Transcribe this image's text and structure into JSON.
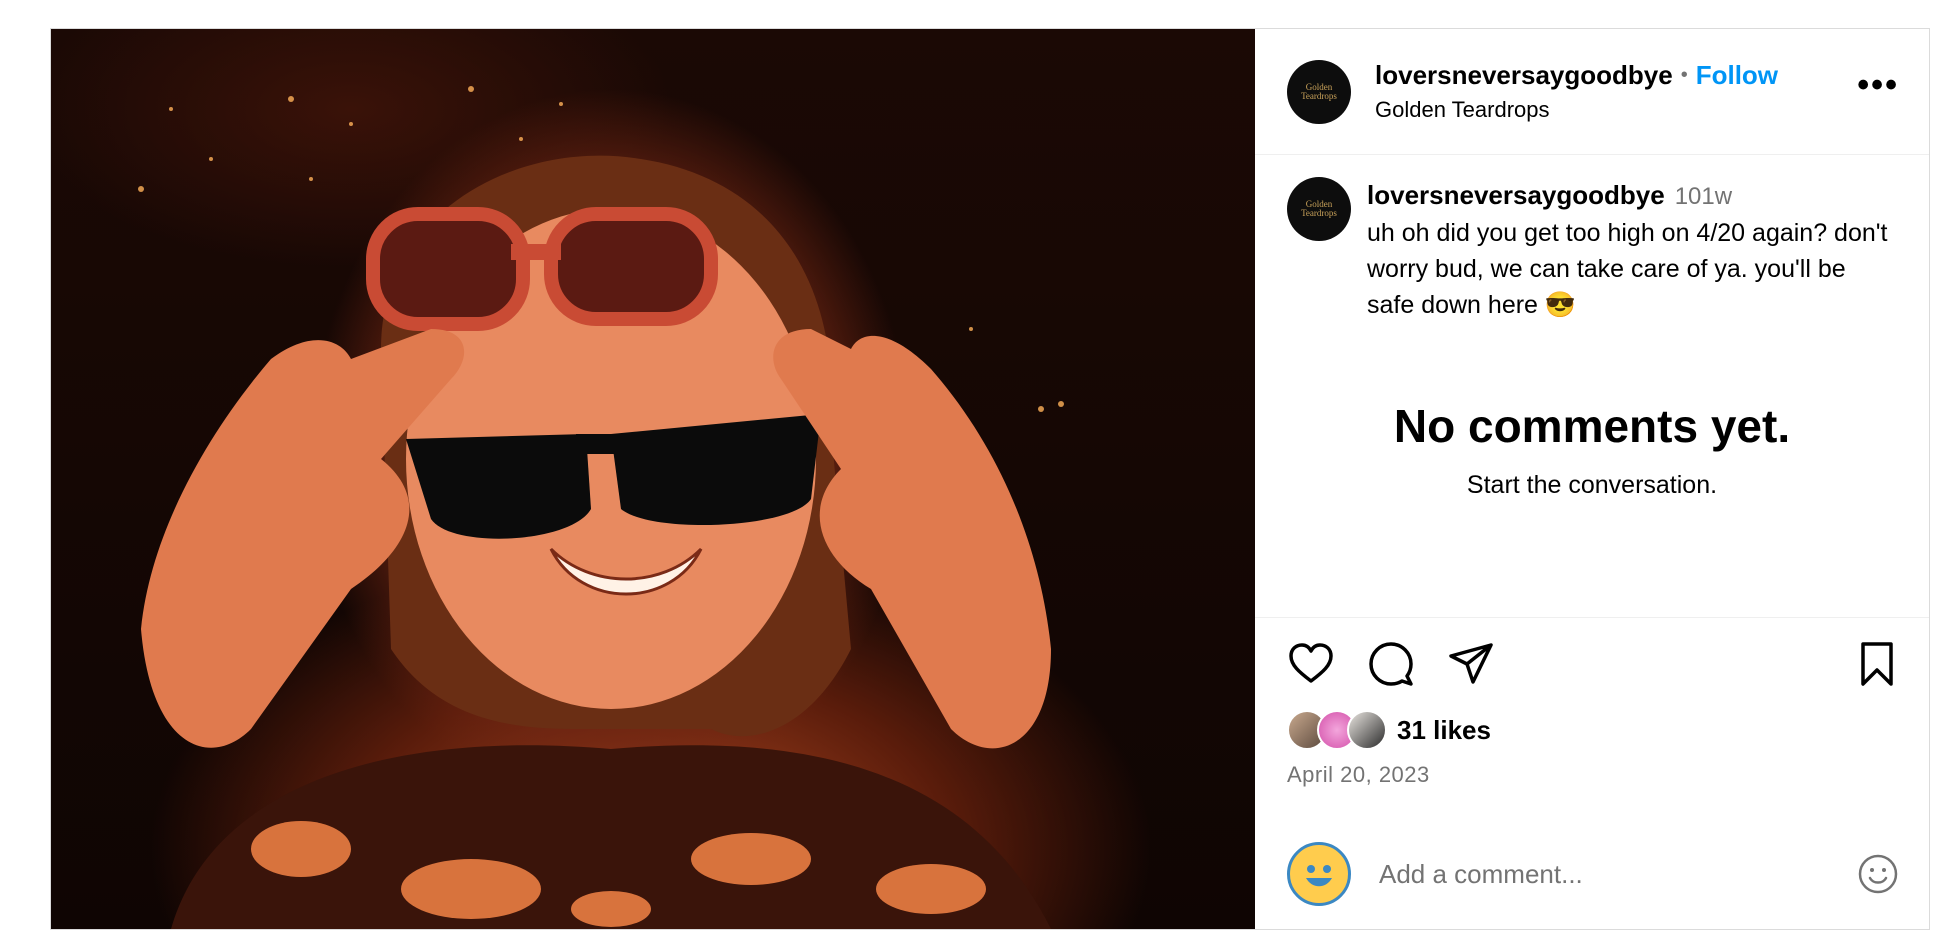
{
  "post": {
    "username": "loversneversaygoodbye",
    "follow_label": "Follow",
    "separator": "•",
    "location": "Golden Teardrops",
    "avatar_text": "Golden Teardrops",
    "more_label": "•••"
  },
  "caption": {
    "username": "loversneversaygoodbye",
    "time": "101w",
    "text": "uh oh did you get too high on 4/20 again? don't worry bud, we can take care of ya. you'll be safe down here 😎"
  },
  "comments": {
    "empty_title": "No comments yet.",
    "empty_subtitle": "Start the conversation."
  },
  "actions": {
    "likes": "31 likes",
    "date": "April 20, 2023"
  },
  "composer": {
    "placeholder": "Add a comment..."
  },
  "colors": {
    "accent": "#0095f6",
    "muted": "#737373",
    "border": "#dbdbdb"
  },
  "icons": [
    "heart-icon",
    "comment-icon",
    "share-icon",
    "bookmark-icon",
    "emoji-icon"
  ]
}
